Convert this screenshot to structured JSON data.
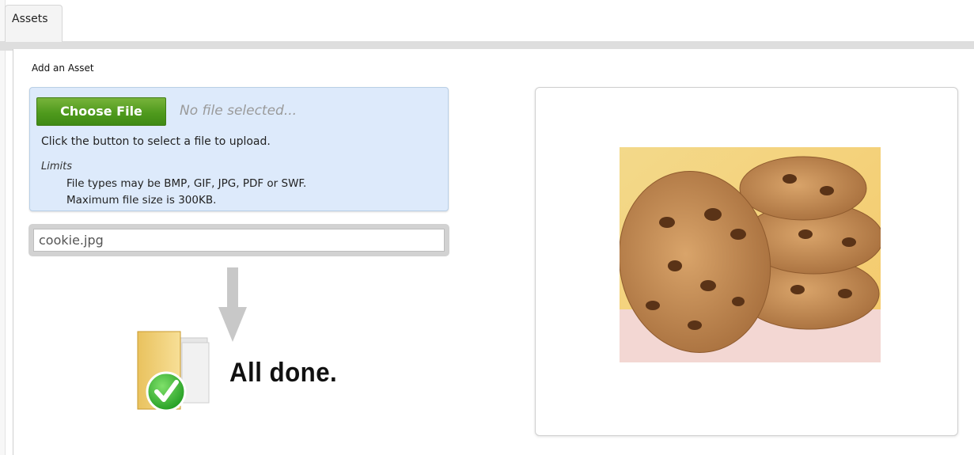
{
  "tabs": [
    {
      "label": "Assets",
      "active": true
    }
  ],
  "section": {
    "title": "Add an Asset"
  },
  "upload": {
    "choose_label": "Choose File",
    "no_file_text": "No file selected...",
    "help_text": "Click the button to select a file to upload.",
    "limits_title": "Limits",
    "limits": [
      "File types may be BMP, GIF, JPG, PDF or SWF.",
      "Maximum file size is 300KB."
    ]
  },
  "file_field": {
    "value": "cookie.jpg"
  },
  "status": {
    "text": "All done.",
    "icon": "folder-check-icon"
  },
  "preview": {
    "image": "cookie-photo"
  },
  "colors": {
    "button_green": "#4f9a1d",
    "upload_box_bg": "#ddeafb",
    "check_green": "#2fae2a"
  }
}
